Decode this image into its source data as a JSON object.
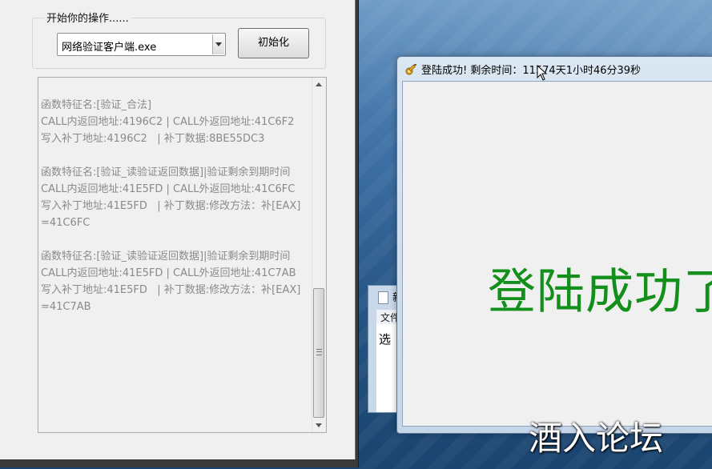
{
  "left_app": {
    "group_title": "开始你的操作......",
    "process_combo": {
      "value": "网络验证客户端.exe"
    },
    "init_button": "初始化",
    "log_lines": [
      "函数特征名:[验证_合法]",
      "CALL内返回地址:4196C2 | CALL外返回地址:41C6F2",
      "写入补丁地址:4196C2   | 补丁数据:8BE55DC3",
      "",
      "函数特征名:[验证_读验证返回数据]|验证剩余到期时间",
      "CALL内返回地址:41E5FD | CALL外返回地址:41C6FC",
      "写入补丁地址:41E5FD   | 补丁数据:修改方法：补[EAX] =41C6FC",
      "",
      "函数特征名:[验证_读验证返回数据]|验证剩余到期时间",
      "CALL内返回地址:41E5FD | CALL外返回地址:41C7AB",
      "写入补丁地址:41E5FD   | 补丁数据:修改方法：补[EAX] =41C7AB"
    ]
  },
  "background_window": {
    "title": "新",
    "menu_file": "文件",
    "body_text": "选"
  },
  "success_window": {
    "title": "登陆成功! 剩余时间：11574天1小时46分39秒",
    "message": "登陆成功了"
  },
  "watermark": "酒入论坛",
  "colors": {
    "success_green": "#12901b",
    "log_gray": "#8a8a8a"
  }
}
